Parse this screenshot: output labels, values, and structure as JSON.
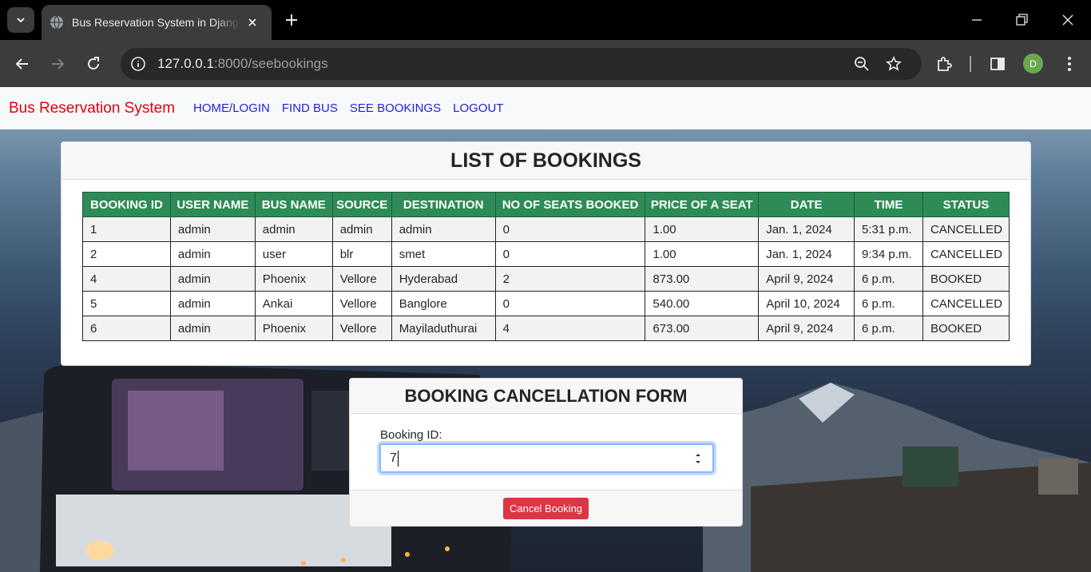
{
  "browser": {
    "tab_title": "Bus Reservation System in Django",
    "url_host": "127.0.0.1",
    "url_path": ":8000/seebookings",
    "profile_initial": "D"
  },
  "navbar": {
    "brand": "Bus Reservation System",
    "links": [
      "HOME/LOGIN",
      "FIND BUS",
      "SEE BOOKINGS",
      "LOGOUT"
    ]
  },
  "bookings": {
    "title": "LIST OF BOOKINGS",
    "columns": [
      "BOOKING ID",
      "USER NAME",
      "BUS NAME",
      "SOURCE",
      "DESTINATION",
      "NO OF SEATS BOOKED",
      "PRICE OF A SEAT",
      "DATE",
      "TIME",
      "STATUS"
    ],
    "rows": [
      [
        "1",
        "admin",
        "admin",
        "admin",
        "admin",
        "0",
        "1.00",
        "Jan. 1, 2024",
        "5:31 p.m.",
        "CANCELLED"
      ],
      [
        "2",
        "admin",
        "user",
        "blr",
        "smet",
        "0",
        "1.00",
        "Jan. 1, 2024",
        "9:34 p.m.",
        "CANCELLED"
      ],
      [
        "4",
        "admin",
        "Phoenix",
        "Vellore",
        "Hyderabad",
        "2",
        "873.00",
        "April 9, 2024",
        "6 p.m.",
        "BOOKED"
      ],
      [
        "5",
        "admin",
        "Ankai",
        "Vellore",
        "Banglore",
        "0",
        "540.00",
        "April 10, 2024",
        "6 p.m.",
        "CANCELLED"
      ],
      [
        "6",
        "admin",
        "Phoenix",
        "Vellore",
        "Mayiladuthurai",
        "4",
        "673.00",
        "April 9, 2024",
        "6 p.m.",
        "BOOKED"
      ]
    ]
  },
  "cancel_form": {
    "title": "BOOKING CANCELLATION FORM",
    "label": "Booking ID:",
    "value": "7",
    "button": "Cancel Booking"
  },
  "colors": {
    "table_header": "#2e8b57",
    "brand": "#e3000f",
    "danger": "#dc3545"
  }
}
